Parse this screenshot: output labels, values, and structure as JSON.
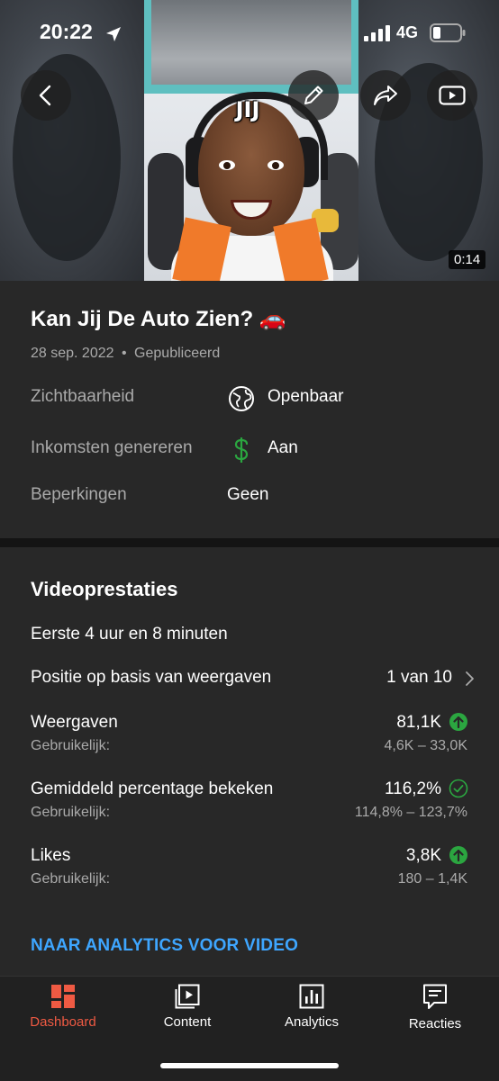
{
  "status_bar": {
    "time": "20:22",
    "network": "4G"
  },
  "video": {
    "duration": "0:14",
    "overlay_text": "JIJ"
  },
  "details": {
    "title": "Kan Jij De Auto Zien? 🚗",
    "date": "28 sep. 2022",
    "separator": "•",
    "status": "Gepubliceerd",
    "rows": [
      {
        "label": "Zichtbaarheid",
        "value": "Openbaar",
        "icon": "globe-icon"
      },
      {
        "label": "Inkomsten genereren",
        "value": "Aan",
        "icon": "dollar-icon"
      },
      {
        "label": "Beperkingen",
        "value": "Geen"
      }
    ]
  },
  "performance": {
    "title": "Videoprestaties",
    "period": "Eerste 4 uur en 8 minuten",
    "rank_label": "Positie op basis van weergaven",
    "rank_value": "1 van 10",
    "metrics": [
      {
        "label": "Weergaven",
        "value": "81,1K",
        "sub_label": "Gebruikelijk:",
        "range": "4,6K – 33,0K",
        "status": "above",
        "icon": "arrow-up-circle-icon"
      },
      {
        "label": "Gemiddeld percentage bekeken",
        "value": "116,2%",
        "sub_label": "Gebruikelijk:",
        "range": "114,8% – 123,7%",
        "status": "typical",
        "icon": "check-circle-icon"
      },
      {
        "label": "Likes",
        "value": "3,8K",
        "sub_label": "Gebruikelijk:",
        "range": "180 – 1,4K",
        "status": "above",
        "icon": "arrow-up-circle-icon"
      }
    ],
    "analytics_link": "NAAR ANALYTICS VOOR VIDEO"
  },
  "nav": {
    "items": [
      {
        "label": "Dashboard",
        "icon": "dashboard-icon",
        "active": true
      },
      {
        "label": "Content",
        "icon": "content-icon",
        "active": false
      },
      {
        "label": "Analytics",
        "icon": "analytics-icon",
        "active": false
      },
      {
        "label": "Reacties",
        "icon": "comments-icon",
        "active": false
      }
    ]
  },
  "colors": {
    "accent_active": "#ef5a43",
    "link": "#3ea6ff",
    "positive": "#2ba640",
    "background": "#282828",
    "nav_background": "#212121"
  }
}
